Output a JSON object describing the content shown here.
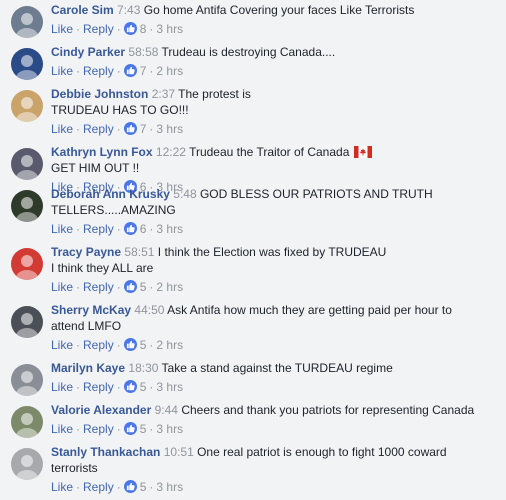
{
  "ui": {
    "like": "Like",
    "reply": "Reply",
    "dot": "·"
  },
  "comments": [
    {
      "author": "Carole Sim",
      "time": "7:43",
      "lines": [
        "Go home Antifa Covering your faces Like Terrorists"
      ],
      "likes": "8",
      "age": "3 hrs",
      "avatar_color": "#6d7c8f"
    },
    {
      "author": "Cindy Parker",
      "time": "58:58",
      "lines": [
        "Trudeau is destroying Canada...."
      ],
      "likes": "7",
      "age": "2 hrs",
      "avatar_color": "#2a4a88"
    },
    {
      "author": "Debbie Johnston",
      "time": "2:37",
      "lines": [
        "The protest is",
        "TRUDEAU HAS TO GO!!!"
      ],
      "likes": "7",
      "age": "3 hrs",
      "avatar_color": "#c9a36a"
    },
    {
      "author": "Kathryn Lynn Fox",
      "time": "12:22",
      "lines": [
        "Trudeau the Traitor of Canada",
        "GET HIM OUT !!"
      ],
      "has_flag": true,
      "likes": "6",
      "age": "3 hrs",
      "avatar_color": "#5a5a6e"
    },
    {
      "author": "Deborah Ann Krusky",
      "time": "5:48",
      "lines": [
        "GOD BLESS OUR PATRIOTS AND TRUTH",
        "TELLERS.....AMAZING"
      ],
      "likes": "6",
      "age": "3 hrs",
      "avatar_color": "#2f3b2a"
    },
    {
      "author": "Tracy Payne",
      "time": "58:51",
      "lines": [
        "I think the Election was fixed by TRUDEAU",
        "I think they ALL are"
      ],
      "likes": "5",
      "age": "2 hrs",
      "avatar_color": "#d23b34"
    },
    {
      "author": "Sherry McKay",
      "time": "44:50",
      "lines": [
        "Ask Antifa how much they are getting paid per hour to",
        "attend LMFO"
      ],
      "likes": "5",
      "age": "2 hrs",
      "avatar_color": "#4b4f57"
    },
    {
      "author": "Marilyn Kaye",
      "time": "18:30",
      "lines": [
        "Take a stand against the TURDEAU regime"
      ],
      "likes": "5",
      "age": "3 hrs",
      "avatar_color": "#8a8e96"
    },
    {
      "author": "Valorie Alexander",
      "time": "9:44",
      "lines": [
        "Cheers and thank you patriots for representing Canada"
      ],
      "likes": "5",
      "age": "3 hrs",
      "avatar_color": "#7c8a6a"
    },
    {
      "author": "Stanly Thankachan",
      "time": "10:51",
      "lines": [
        "One real patriot is enough to fight 1000 coward",
        "terrorists"
      ],
      "likes": "5",
      "age": "3 hrs",
      "avatar_color": "#a7a9ad"
    }
  ]
}
